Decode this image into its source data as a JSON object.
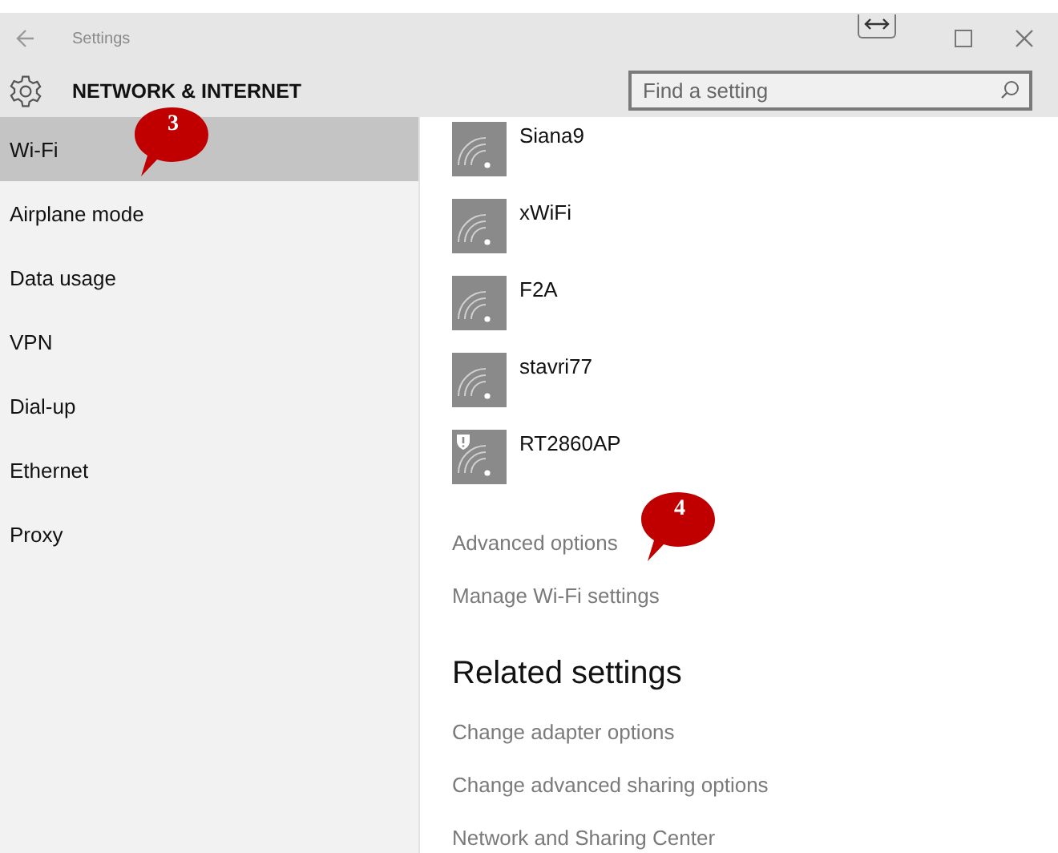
{
  "window": {
    "title": "Settings"
  },
  "header": {
    "title": "NETWORK & INTERNET",
    "search": {
      "placeholder": "Find a setting"
    }
  },
  "sidebar": {
    "items": [
      {
        "label": "Wi-Fi",
        "selected": true
      },
      {
        "label": "Airplane mode",
        "selected": false
      },
      {
        "label": "Data usage",
        "selected": false
      },
      {
        "label": "VPN",
        "selected": false
      },
      {
        "label": "Dial-up",
        "selected": false
      },
      {
        "label": "Ethernet",
        "selected": false
      },
      {
        "label": "Proxy",
        "selected": false
      }
    ]
  },
  "networks": [
    {
      "name": "Siana9",
      "secured": false
    },
    {
      "name": "xWiFi",
      "secured": false
    },
    {
      "name": "F2A",
      "secured": false
    },
    {
      "name": "stavri77",
      "secured": false
    },
    {
      "name": "RT2860AP",
      "secured": true
    }
  ],
  "links": [
    "Advanced options",
    "Manage Wi-Fi settings"
  ],
  "related": {
    "title": "Related settings",
    "links": [
      "Change adapter options",
      "Change advanced sharing options",
      "Network and Sharing Center"
    ]
  },
  "callouts": [
    {
      "number": "3"
    },
    {
      "number": "4"
    }
  ]
}
